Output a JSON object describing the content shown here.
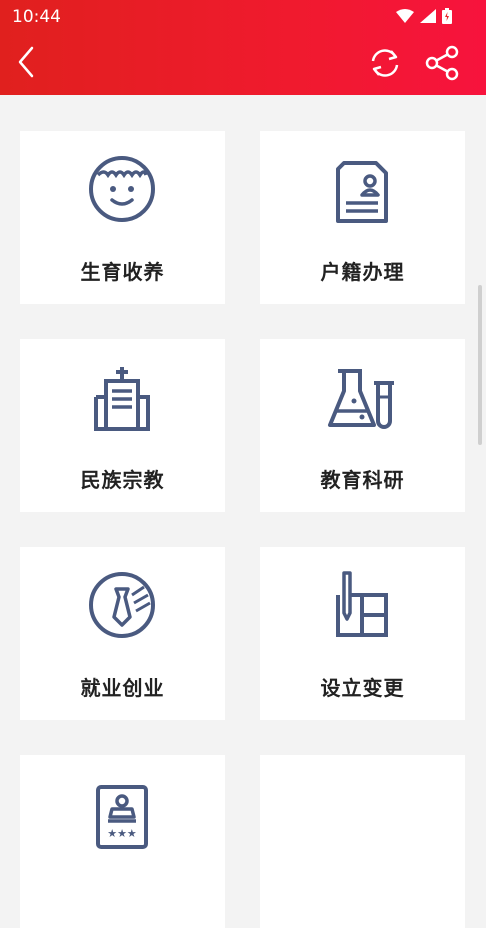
{
  "status_bar": {
    "time": "10:44"
  },
  "colors": {
    "header_start": "#e0201e",
    "header_end": "#f7133d",
    "icon": "#4a5a80",
    "label": "#222222"
  },
  "nav": {
    "back_icon": "chevron-left-icon",
    "refresh_icon": "refresh-icon",
    "share_icon": "share-icon"
  },
  "cards": [
    {
      "label": "生育收养",
      "icon": "baby-face-icon"
    },
    {
      "label": "户籍办理",
      "icon": "household-document-icon"
    },
    {
      "label": "民族宗教",
      "icon": "religion-building-icon"
    },
    {
      "label": "教育科研",
      "icon": "lab-flask-icon"
    },
    {
      "label": "就业创业",
      "icon": "tie-badge-icon"
    },
    {
      "label": "设立变更",
      "icon": "pen-form-icon"
    },
    {
      "label": "",
      "icon": "certificate-stamp-icon"
    },
    {
      "label": "",
      "icon": ""
    }
  ]
}
